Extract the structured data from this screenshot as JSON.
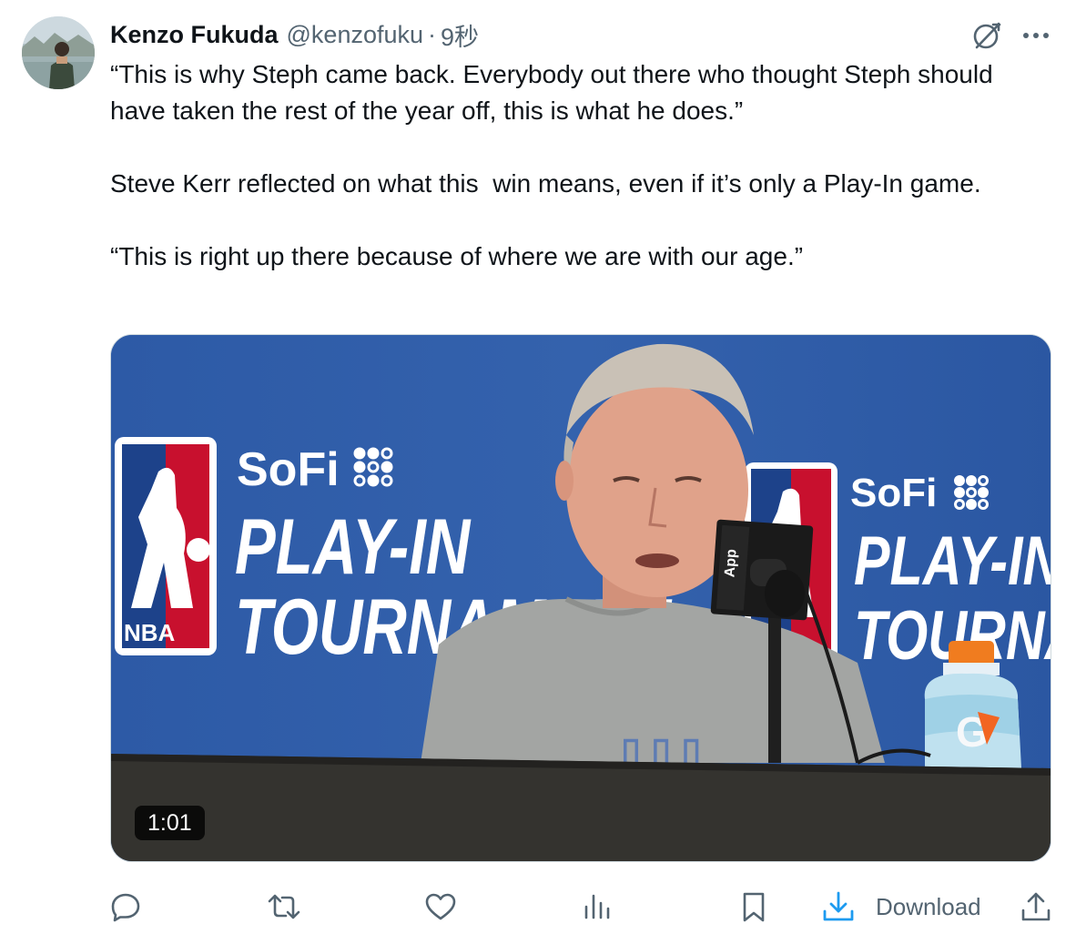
{
  "author": {
    "display_name": "Kenzo Fukuda",
    "handle": "@kenzofuku",
    "separator": "·",
    "timestamp": "9秒"
  },
  "tweet": {
    "paragraphs": [
      "“This is why Steph came back. Everybody out there who thought Steph should have taken the rest of the year off, this is what he does.”",
      "Steve Kerr reflected on what this  win means, even if it’s only a Play-In game.",
      "“This is right up there because of where we are with our age.”"
    ]
  },
  "media": {
    "type": "video",
    "duration": "1:01",
    "backdrop": {
      "sponsor": "SoFi",
      "line1": "PLAY-IN",
      "line2": "TOURNAMENT",
      "league": "NBA",
      "mic_flag": "App",
      "bottle_mark": "G"
    }
  },
  "actions": {
    "reply": "reply-icon",
    "repost": "repost-icon",
    "like": "heart-icon",
    "views": "analytics-icon",
    "bookmark": "bookmark-icon",
    "download_label": "Download",
    "share": "share-icon"
  },
  "colors": {
    "text_primary": "#0f1419",
    "text_secondary": "#536471",
    "accent": "#1d9bf0",
    "backdrop_blue": "#2f5ea8"
  }
}
